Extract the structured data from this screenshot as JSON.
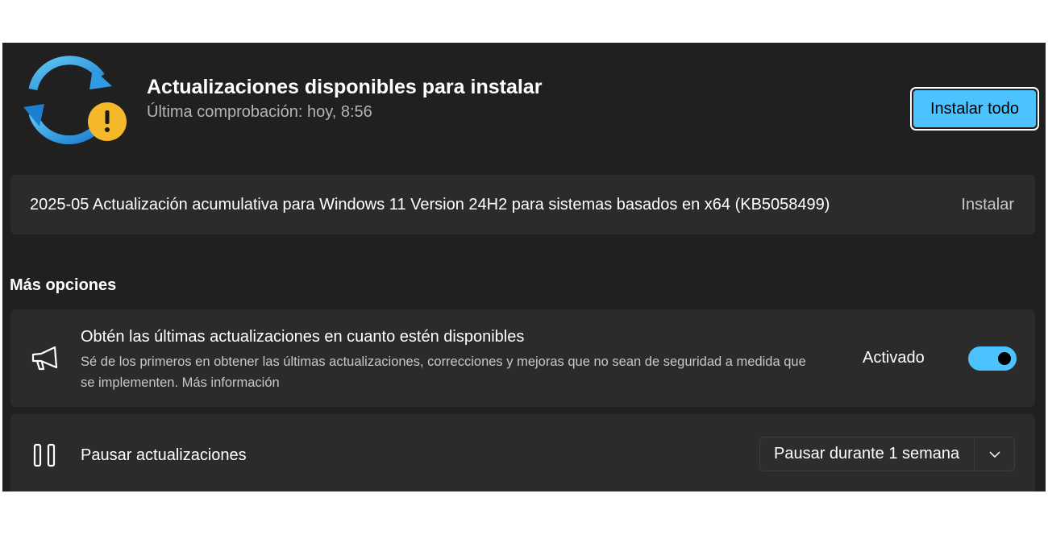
{
  "header": {
    "title": "Actualizaciones disponibles para instalar",
    "subtitle": "Última comprobación: hoy, 8:56",
    "install_all_label": "Instalar todo",
    "status_icon": "sync-warning-icon"
  },
  "updates": [
    {
      "name": "2025-05 Actualización acumulativa para Windows 11 Version 24H2 para sistemas basados en x64 (KB5058499)",
      "action_label": "Instalar"
    }
  ],
  "more_options": {
    "title": "Más opciones",
    "latest_updates": {
      "icon": "megaphone-icon",
      "title": "Obtén las últimas actualizaciones en cuanto estén disponibles",
      "description": "Sé de los primeros en obtener las últimas actualizaciones, correcciones y mejoras que no sean de seguridad a medida que se implementen.",
      "link_label": "Más información",
      "state_label": "Activado",
      "toggle_on": true
    },
    "pause": {
      "icon": "pause-icon",
      "label": "Pausar actualizaciones",
      "selected_option": "Pausar durante 1 semana"
    }
  },
  "colors": {
    "accent": "#4cc2ff",
    "warning": "#f5b82b",
    "background": "#202020",
    "card": "#2b2b2b"
  }
}
